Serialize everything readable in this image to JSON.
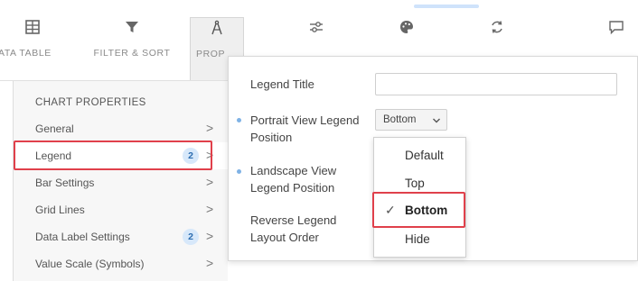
{
  "toolbar": {
    "tools": [
      {
        "label": "ATA TABLE",
        "icon": "data-table-icon"
      },
      {
        "label": "FILTER & SORT",
        "icon": "filter-icon"
      },
      {
        "label": "PROP",
        "icon": "properties-icon",
        "active": true
      },
      {
        "label": "",
        "icon": "sliders-icon"
      },
      {
        "label": "",
        "icon": "palette-icon"
      },
      {
        "label": "",
        "icon": "refresh-icon"
      },
      {
        "label": "",
        "icon": "comment-icon"
      }
    ]
  },
  "chart_properties": {
    "heading": "CHART PROPERTIES",
    "items": [
      {
        "label": "General",
        "badge": ""
      },
      {
        "label": "Legend",
        "badge": "2",
        "selected": true
      },
      {
        "label": "Bar Settings",
        "badge": ""
      },
      {
        "label": "Grid Lines",
        "badge": ""
      },
      {
        "label": "Data Label Settings",
        "badge": "2"
      },
      {
        "label": "Value Scale (Symbols)",
        "badge": ""
      }
    ],
    "chevron": ">"
  },
  "legend_panel": {
    "legend_title_label": "Legend Title",
    "legend_title_value": "",
    "portrait_label": "Portrait View Legend Position",
    "portrait_value": "Bottom",
    "landscape_label": "Landscape View Legend Position",
    "reverse_label": "Reverse Legend Layout Order"
  },
  "dropdown": {
    "options": [
      {
        "label": "Default",
        "selected": false
      },
      {
        "label": "Top",
        "selected": false
      },
      {
        "label": "Bottom",
        "selected": true
      },
      {
        "label": "Hide",
        "selected": false
      }
    ],
    "check_glyph": "✓"
  },
  "colors": {
    "highlight_outline": "#e0404b",
    "badge_bg": "#d7e8fa",
    "badge_text": "#2d6db0",
    "dot": "#7fb2e5"
  }
}
